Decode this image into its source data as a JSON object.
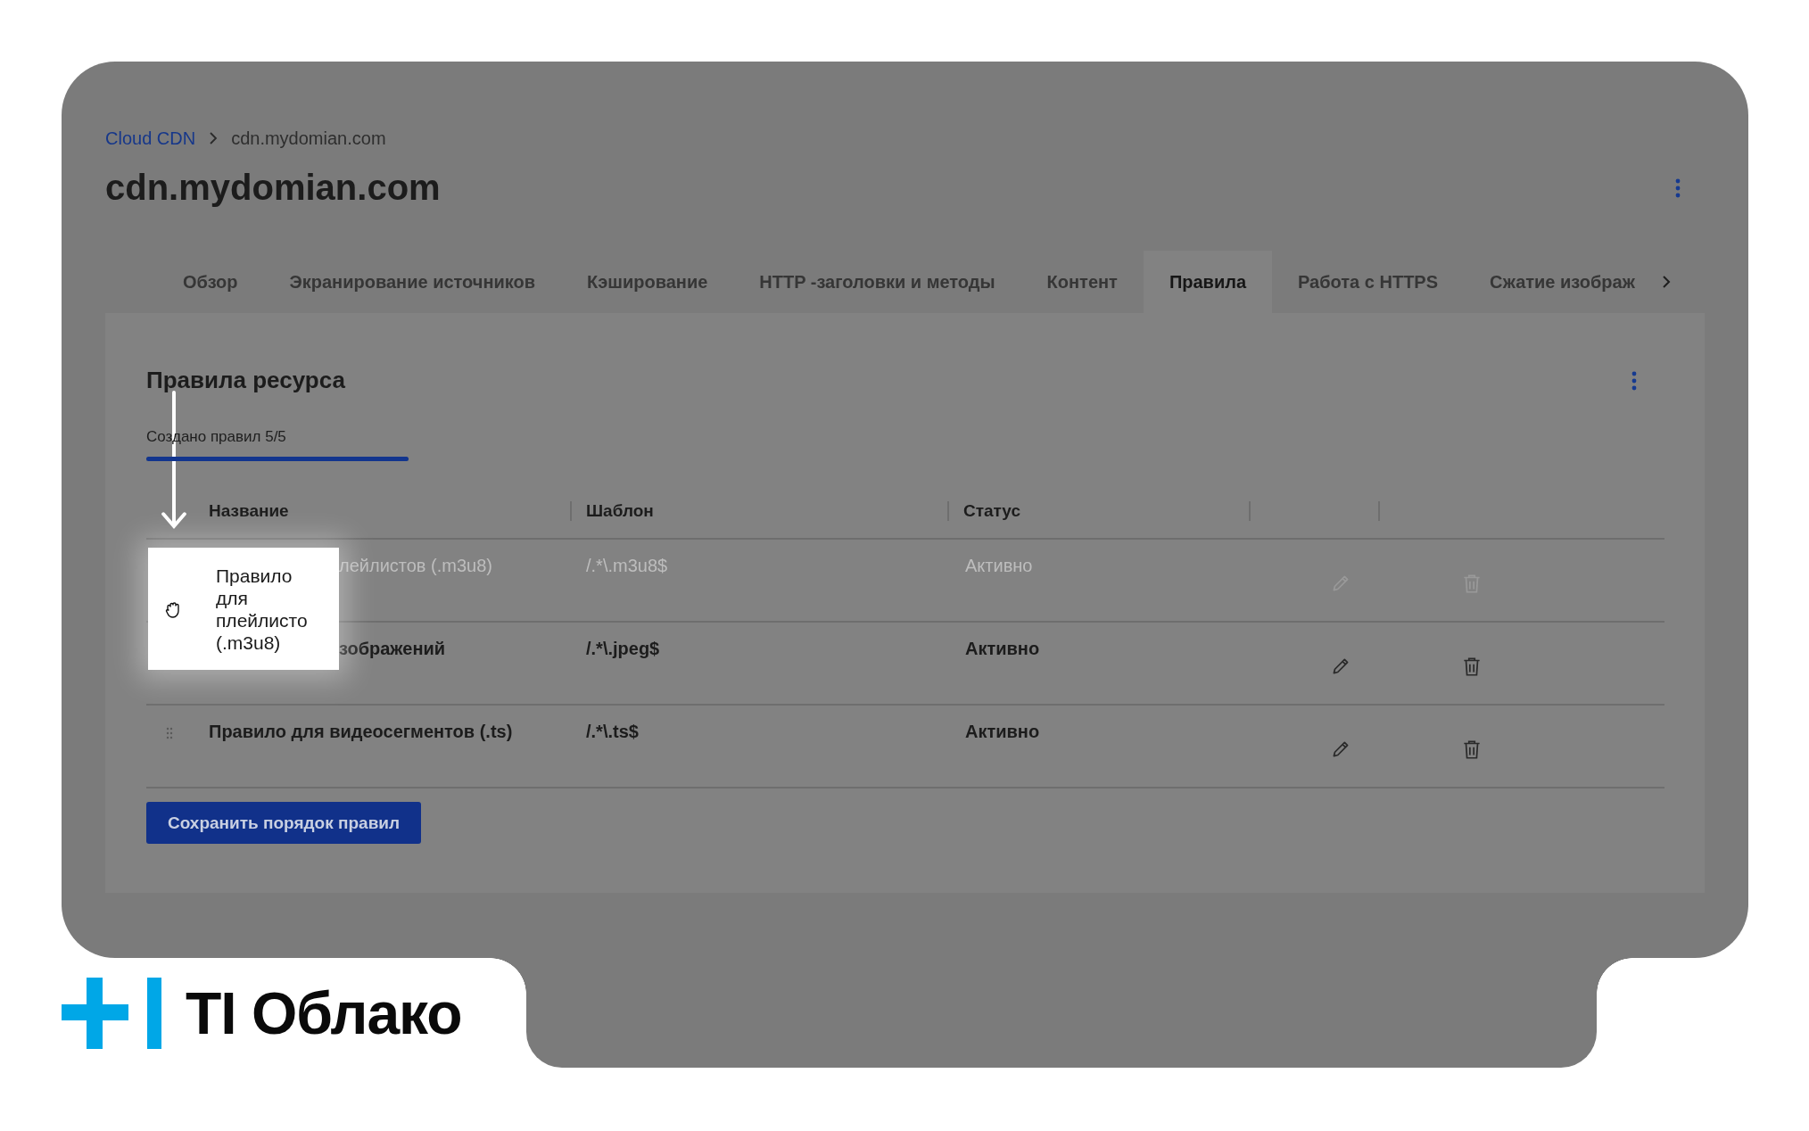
{
  "breadcrumb": [
    {
      "label": "Cloud CDN",
      "kind": "link"
    },
    {
      "label": "cdn.mydomian.com",
      "kind": "current"
    }
  ],
  "title": "cdn.mydomian.com",
  "tabs": [
    {
      "label": "Обзор",
      "selected": false
    },
    {
      "label": "Экранирование источников",
      "selected": false
    },
    {
      "label": "Кэширование",
      "selected": false
    },
    {
      "label": "HTTP -заголовки и методы",
      "selected": false
    },
    {
      "label": "Контент",
      "selected": false
    },
    {
      "label": "Правила",
      "selected": true
    },
    {
      "label": "Работа с HTTPS",
      "selected": false
    },
    {
      "label": "Сжатие изображ",
      "selected": false
    }
  ],
  "section": {
    "title": "Правила ресурса",
    "quota": {
      "label": "Создано правил 5/5",
      "level": 1
    }
  },
  "table": {
    "columns": [
      "Название",
      "Шаблон",
      "Статус"
    ],
    "rows": [
      {
        "name": "лейлистов (.m3u8)",
        "pattern": "/.*\\.m3u8$",
        "status": "Активно",
        "dragging": true,
        "obscured": true
      },
      {
        "name": "зображений",
        "pattern": "/.*\\.jpeg$",
        "status": "Активно",
        "dragging": false,
        "obscured": true
      },
      {
        "name": "Правило для видеосегментов (.ts)",
        "pattern": "/.*\\.ts$",
        "status": "Активно",
        "dragging": false,
        "obscured": false
      }
    ]
  },
  "save_button": "Сохранить порядок правил",
  "drag_card": {
    "lines": [
      "Правило",
      "для",
      "плейлисто",
      "(.m3u8)"
    ]
  },
  "logo": "TI Облако"
}
